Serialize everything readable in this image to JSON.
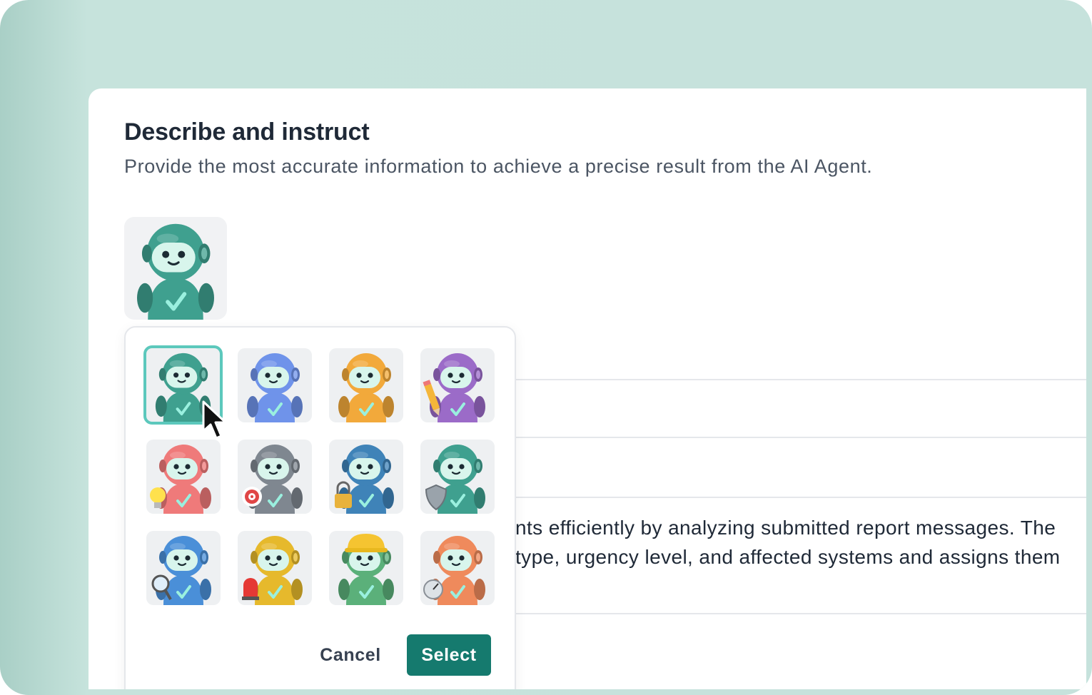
{
  "section": {
    "title": "Describe and instruct",
    "subtitle": "Provide the most accurate information to achieve a precise result from the AI Agent."
  },
  "selected_avatar": {
    "color": "#3fa08f",
    "icon": "robot-checkmark-icon"
  },
  "avatar_picker": {
    "avatars": [
      {
        "color": "#3fa08f",
        "accessory": "none",
        "icon": "robot-teal-icon",
        "selected": true
      },
      {
        "color": "#6f93ea",
        "accessory": "none",
        "icon": "robot-blue-icon",
        "selected": false
      },
      {
        "color": "#f2a93b",
        "accessory": "none",
        "icon": "robot-orange-icon",
        "selected": false
      },
      {
        "color": "#9b6bc8",
        "accessory": "pencil",
        "icon": "robot-purple-pencil-icon",
        "selected": false
      },
      {
        "color": "#ef7a7a",
        "accessory": "lightbulb",
        "icon": "robot-red-lightbulb-icon",
        "selected": false
      },
      {
        "color": "#7f8790",
        "accessory": "target",
        "icon": "robot-gray-target-icon",
        "selected": false
      },
      {
        "color": "#3f83b8",
        "accessory": "padlock",
        "icon": "robot-steelblue-padlock-icon",
        "selected": false
      },
      {
        "color": "#3fa08f",
        "accessory": "shield",
        "icon": "robot-teal-shield-icon",
        "selected": false
      },
      {
        "color": "#4a8fd8",
        "accessory": "magnifier",
        "icon": "robot-blue-magnifier-icon",
        "selected": false
      },
      {
        "color": "#e6b92c",
        "accessory": "alarm",
        "icon": "robot-yellow-alarm-icon",
        "selected": false
      },
      {
        "color": "#5bb07a",
        "accessory": "hardhat",
        "icon": "robot-green-hardhat-icon",
        "selected": false
      },
      {
        "color": "#ef8a5c",
        "accessory": "gauge",
        "icon": "robot-coral-gauge-icon",
        "selected": false
      }
    ],
    "cancel_label": "Cancel",
    "select_label": "Select"
  },
  "description": {
    "line1": "nts efficiently by analyzing submitted report messages. The",
    "line2": "type, urgency level, and affected systems and assigns them"
  },
  "colors": {
    "background": "#c6e2dc",
    "accent": "#157a6e",
    "selection_border": "#5cc8bc"
  }
}
